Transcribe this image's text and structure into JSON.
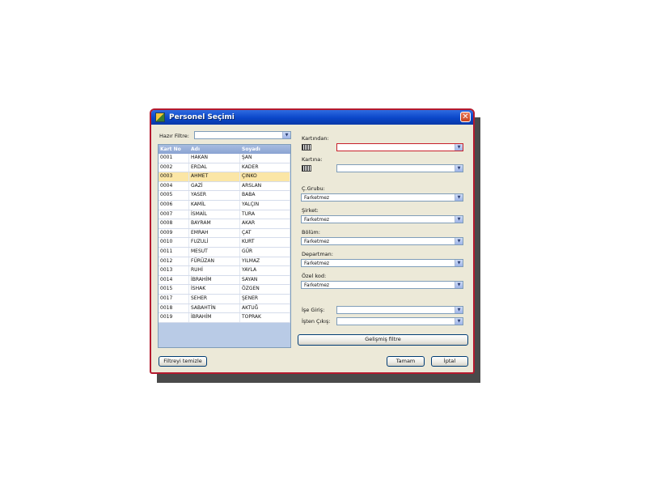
{
  "window": {
    "title": "Personel Seçimi",
    "close_glyph": "✕"
  },
  "filter": {
    "label": "Hazır Filtre:",
    "value": ""
  },
  "grid": {
    "columns": [
      "Kart No",
      "Adı",
      "Soyadı"
    ],
    "selected_index": 2,
    "rows": [
      [
        "0001",
        "HAKAN",
        "ŞAN"
      ],
      [
        "0002",
        "ERDAL",
        "KADER"
      ],
      [
        "0003",
        "AHMET",
        "ÇINKO"
      ],
      [
        "0004",
        "GAZİ",
        "ARSLAN"
      ],
      [
        "0005",
        "YASER",
        "BABA"
      ],
      [
        "0006",
        "KAMİL",
        "YALÇIN"
      ],
      [
        "0007",
        "İSMAİL",
        "TURA"
      ],
      [
        "0008",
        "BAYRAM",
        "AKAR"
      ],
      [
        "0009",
        "EMRAH",
        "ÇAT"
      ],
      [
        "0010",
        "FUZULİ",
        "KURT"
      ],
      [
        "0011",
        "MESUT",
        "GÜR"
      ],
      [
        "0012",
        "FÜRÜZAN",
        "YILMAZ"
      ],
      [
        "0013",
        "RUHİ",
        "YAYLA"
      ],
      [
        "0014",
        "İBRAHİM",
        "SAYAN"
      ],
      [
        "0015",
        "İSHAK",
        "ÖZGEN"
      ],
      [
        "0017",
        "SEHER",
        "ŞENER"
      ],
      [
        "0018",
        "SABAHTİN",
        "AKTUĞ"
      ],
      [
        "0019",
        "İBRAHİM",
        "TOPRAK"
      ]
    ]
  },
  "right": {
    "kartindan": {
      "label": "Kartından:",
      "value": ""
    },
    "kartina": {
      "label": "Kartına:",
      "value": ""
    },
    "cgrubu": {
      "label": "Ç.Grubu:",
      "value": "Farketmez"
    },
    "sirket": {
      "label": "Şirket:",
      "value": "Farketmez"
    },
    "bolum": {
      "label": "Bölüm:",
      "value": "Farketmez"
    },
    "departman": {
      "label": "Departman:",
      "value": "Farketmez"
    },
    "ozelkod": {
      "label": "Özel kod:",
      "value": "Farketmez"
    },
    "isegiris": {
      "label": "İşe Giriş:",
      "value": ""
    },
    "istencikis": {
      "label": "İşten Çıkış:",
      "value": ""
    }
  },
  "buttons": {
    "advanced": "Gelişmiş filtre",
    "clear": "Filtreyi temizle",
    "ok": "Tamam",
    "cancel": "İptal"
  },
  "icons": {
    "app": "app-icon",
    "card": "card-reader-icon",
    "dropdown": "chevron-down-icon",
    "close": "close-icon"
  },
  "colors": {
    "window_border": "#b41a2e",
    "titlebar": "#0a46c9",
    "selected_row": "#fbe6a6",
    "focus_border": "#c8202a"
  }
}
